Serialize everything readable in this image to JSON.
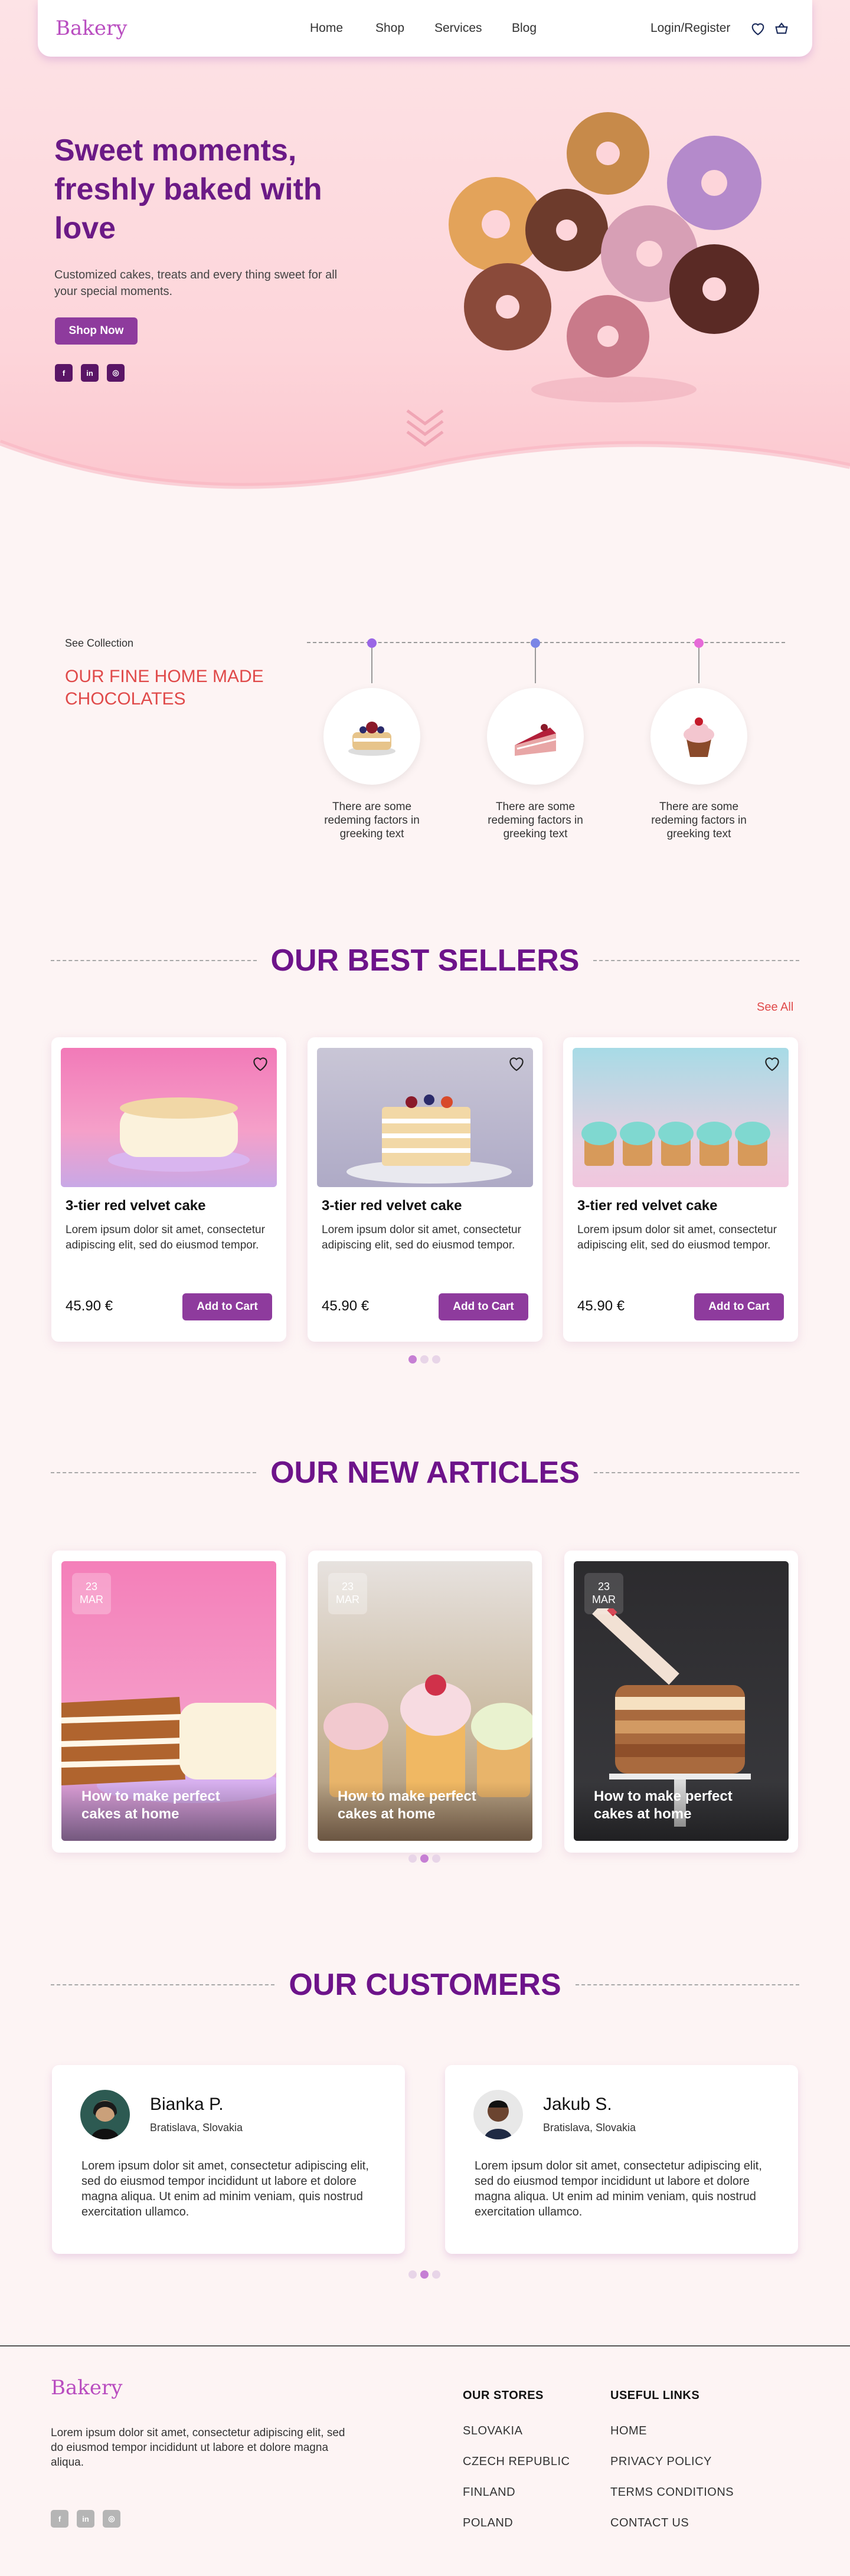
{
  "header": {
    "logo": "Bakery",
    "nav": [
      "Home",
      "Shop",
      "Services",
      "Blog"
    ],
    "login": "Login/Register",
    "icons": [
      "heart-icon",
      "basket-icon"
    ]
  },
  "hero": {
    "title": "Sweet moments, freshly baked with love",
    "subtitle": "Customized cakes, treats and every thing sweet for all your special moments.",
    "cta": "Shop Now",
    "socials": [
      "facebook-icon",
      "linkedin-icon",
      "instagram-icon"
    ]
  },
  "collection": {
    "eyebrow": "See Collection",
    "title": "OUR FINE HOME MADE CHOCOLATES",
    "items": [
      {
        "text": "There are some redeming factors in greeking text",
        "dot": "#9a66e6"
      },
      {
        "text": "There are some redeming factors in greeking text",
        "dot": "#7a86e6"
      },
      {
        "text": "There are some redeming factors in greeking text",
        "dot": "#e66ad8"
      }
    ]
  },
  "best_sellers": {
    "title": "OUR BEST SELLERS",
    "see_all": "See All",
    "products": [
      {
        "name": "3-tier red velvet cake",
        "desc": "Lorem ipsum dolor sit amet, consectetur adipiscing elit, sed do eiusmod tempor.",
        "price": "45.90 €",
        "cta": "Add to Cart"
      },
      {
        "name": "3-tier red velvet cake",
        "desc": "Lorem ipsum dolor sit amet, consectetur adipiscing elit, sed do eiusmod tempor.",
        "price": "45.90 €",
        "cta": "Add to Cart"
      },
      {
        "name": "3-tier red velvet cake",
        "desc": "Lorem ipsum dolor sit amet, consectetur adipiscing elit, sed do eiusmod tempor.",
        "price": "45.90 €",
        "cta": "Add to Cart"
      }
    ],
    "active_dot": 0
  },
  "articles": {
    "title": "OUR NEW ARTICLES",
    "items": [
      {
        "day": "23",
        "month": "MAR",
        "title": "How to make perfect cakes at home"
      },
      {
        "day": "23",
        "month": "MAR",
        "title": "How to make perfect cakes at home"
      },
      {
        "day": "23",
        "month": "MAR",
        "title": "How to make perfect cakes at home"
      }
    ],
    "active_dot": 1
  },
  "customers": {
    "title": "OUR CUSTOMERS",
    "items": [
      {
        "name": "Bianka P.",
        "location": "Bratislava, Slovakia",
        "text": "Lorem ipsum dolor sit amet, consectetur adipiscing elit, sed do eiusmod tempor incididunt ut labore et dolore magna aliqua. Ut enim ad minim veniam, quis nostrud exercitation ullamco."
      },
      {
        "name": "Jakub S.",
        "location": "Bratislava, Slovakia",
        "text": "Lorem ipsum dolor sit amet, consectetur adipiscing elit, sed do eiusmod tempor incididunt ut labore et dolore magna aliqua. Ut enim ad minim veniam, quis nostrud exercitation ullamco."
      }
    ],
    "active_dot": 1
  },
  "footer": {
    "logo": "Bakery",
    "text": "Lorem ipsum dolor sit amet, consectetur adipiscing elit, sed do eiusmod tempor incididunt ut labore et dolore magna aliqua.",
    "stores_title": "OUR STORES",
    "stores": [
      "SLOVAKIA",
      "CZECH REPUBLIC",
      "FINLAND",
      "POLAND"
    ],
    "links_title": "USEFUL LINKS",
    "links": [
      "HOME",
      "PRIVACY POLICY",
      "TERMS CONDITIONS",
      "CONTACT US"
    ],
    "socials": [
      "facebook-icon",
      "linkedin-icon",
      "instagram-icon"
    ]
  },
  "colors": {
    "accent": "#8e3b9d",
    "title": "#6d138a",
    "collection_title": "#e04a4a",
    "logo": "#b94dc0",
    "bg": "#fdf4f4"
  }
}
